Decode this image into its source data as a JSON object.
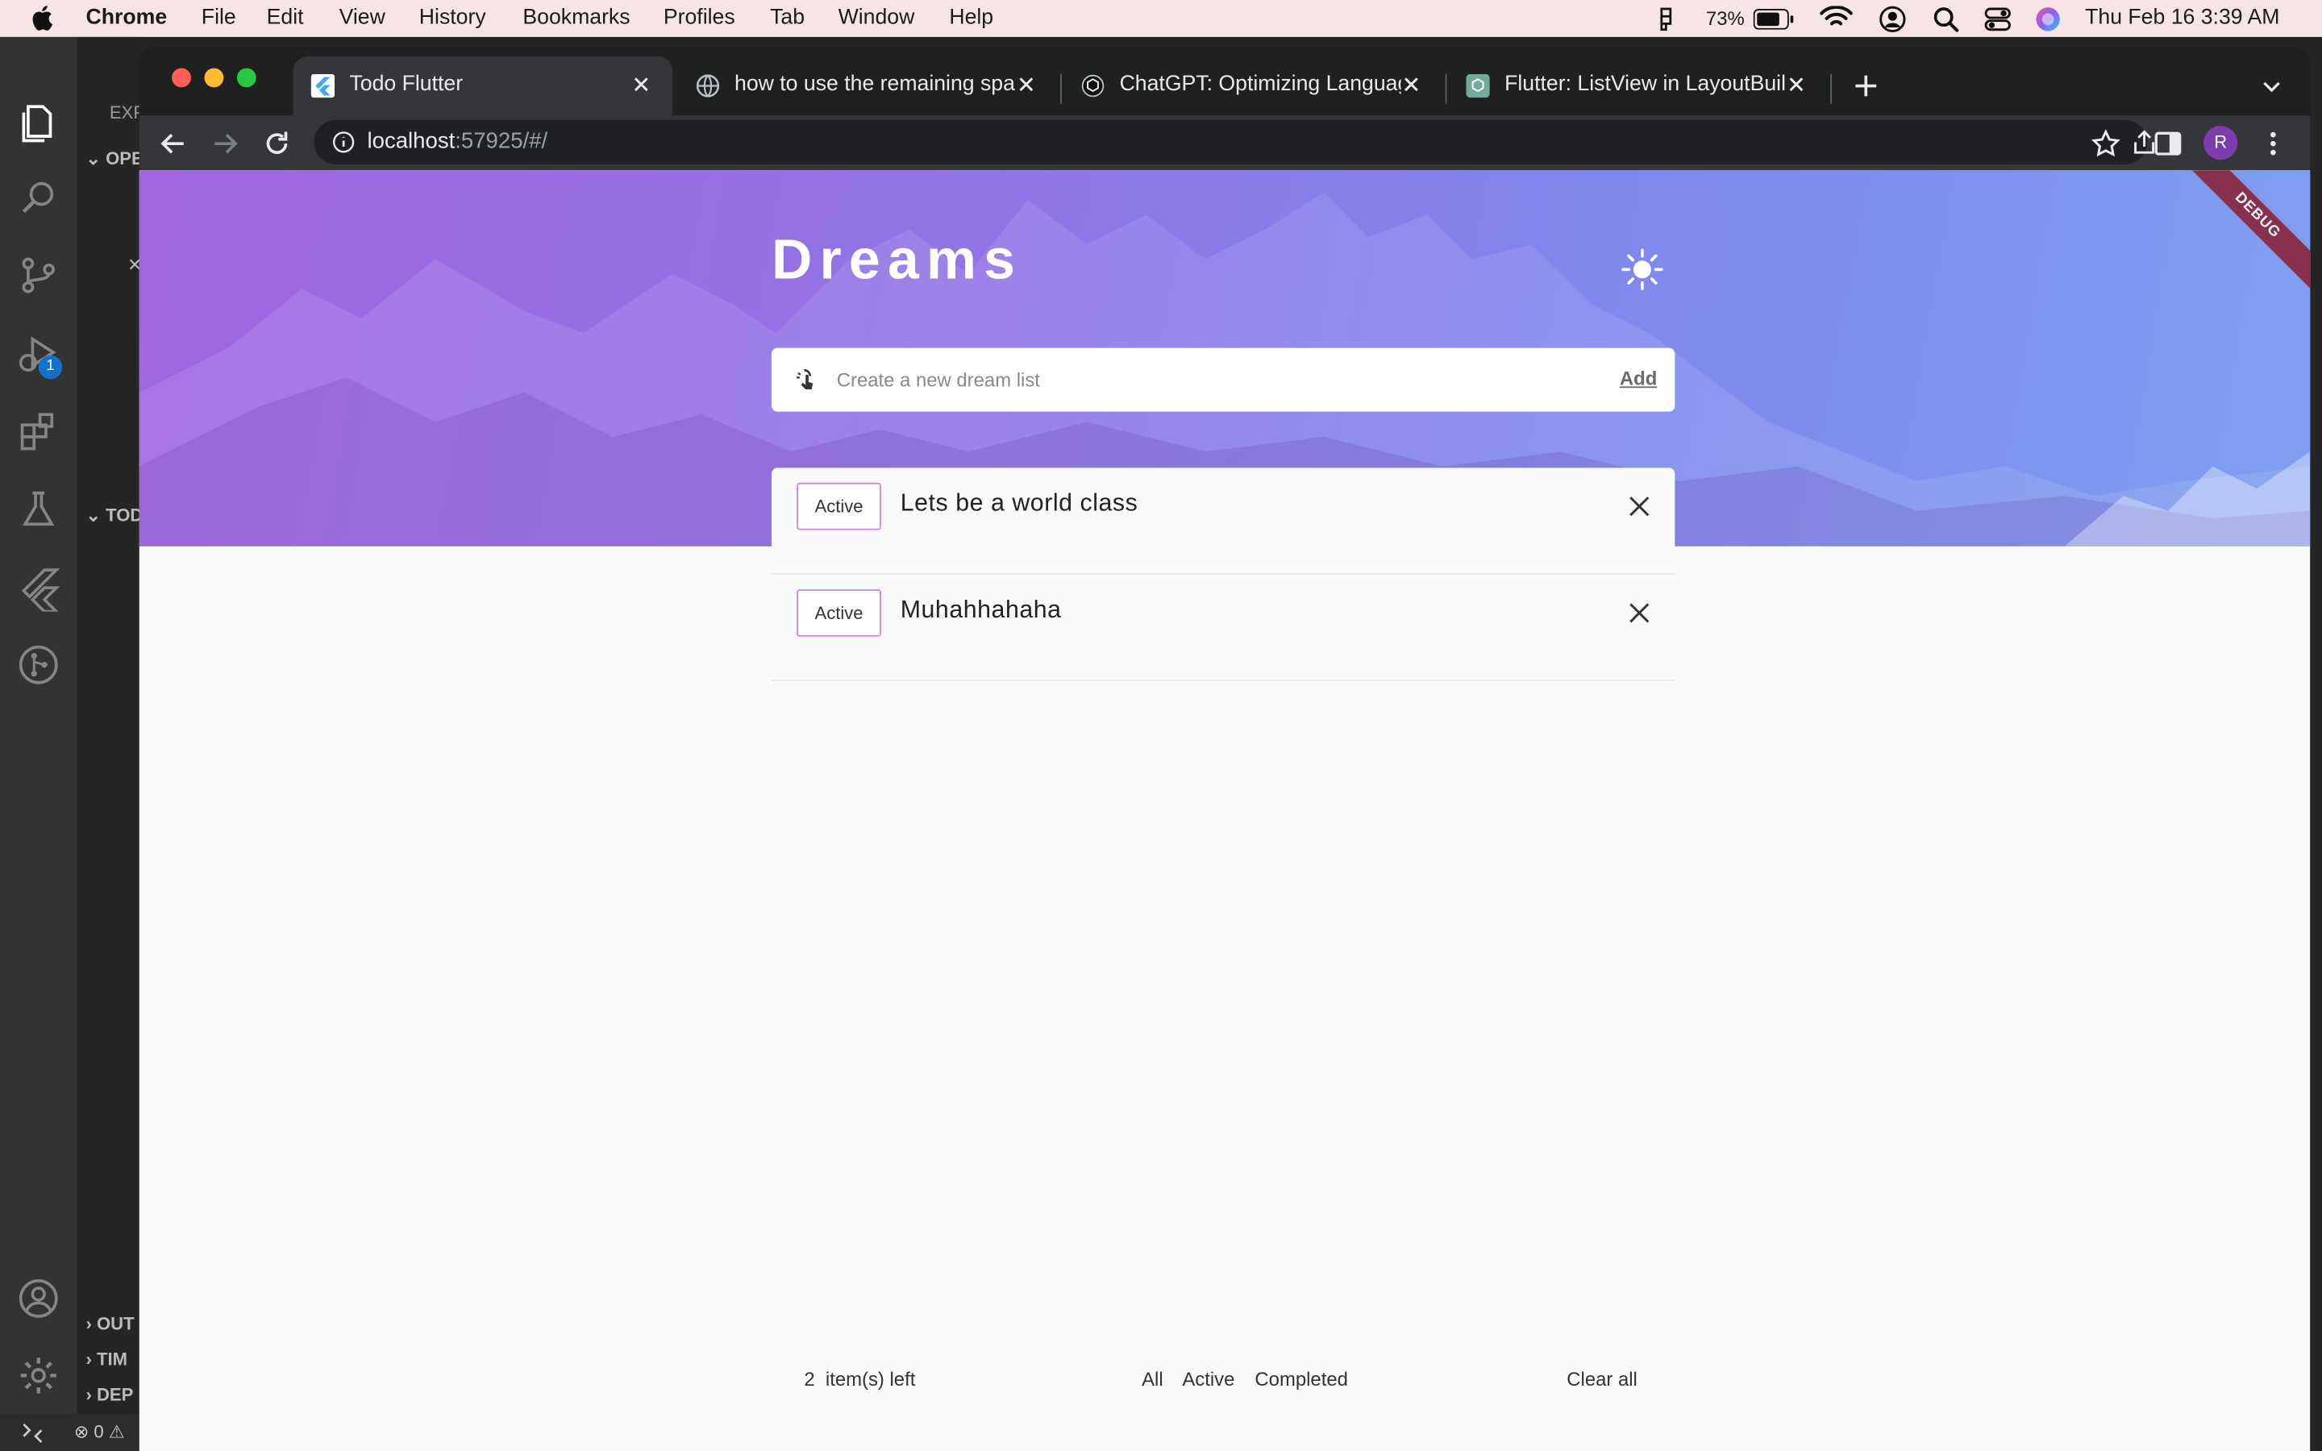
{
  "menubar": {
    "app": "Chrome",
    "menus": [
      "File",
      "Edit",
      "View",
      "History",
      "Bookmarks",
      "Profiles",
      "Tab",
      "Window",
      "Help"
    ],
    "battery": "73%",
    "datetime": "Thu Feb 16  3:39 AM"
  },
  "vscode": {
    "explorer_label": "EXPL",
    "open_editors": "OPEN",
    "section_tod": "TOD",
    "outline": "OUT",
    "timeline": "TIM",
    "dependencies": "DEP",
    "debug_badge": "1",
    "status_errors": "0"
  },
  "browser": {
    "tabs": [
      {
        "title": "Todo Flutter",
        "active": true
      },
      {
        "title": "how to use the remaining space",
        "active": false
      },
      {
        "title": "ChatGPT: Optimizing Language",
        "active": false
      },
      {
        "title": "Flutter: ListView in LayoutBuilder",
        "active": false
      }
    ],
    "url_host": "localhost",
    "url_path": ":57925/#/",
    "profile_initial": "R"
  },
  "app": {
    "title": "Dreams",
    "debug_label": "DEBUG",
    "new_placeholder": "Create a new dream list",
    "add_label": "Add",
    "items": [
      {
        "status": "Active",
        "text": "Lets be a world class"
      },
      {
        "status": "Active",
        "text": "Muhahhahaha"
      }
    ],
    "footer": {
      "count": "2",
      "left_suffix": "item(s) left",
      "filter_all": "All",
      "filter_active": "Active",
      "filter_completed": "Completed",
      "clear": "Clear all"
    }
  },
  "colors": {
    "hero_start": "#a066e0",
    "hero_end": "#7f9ff0",
    "chip_border": "#cc88dd",
    "debug_ribbon": "#8a1e2f"
  }
}
